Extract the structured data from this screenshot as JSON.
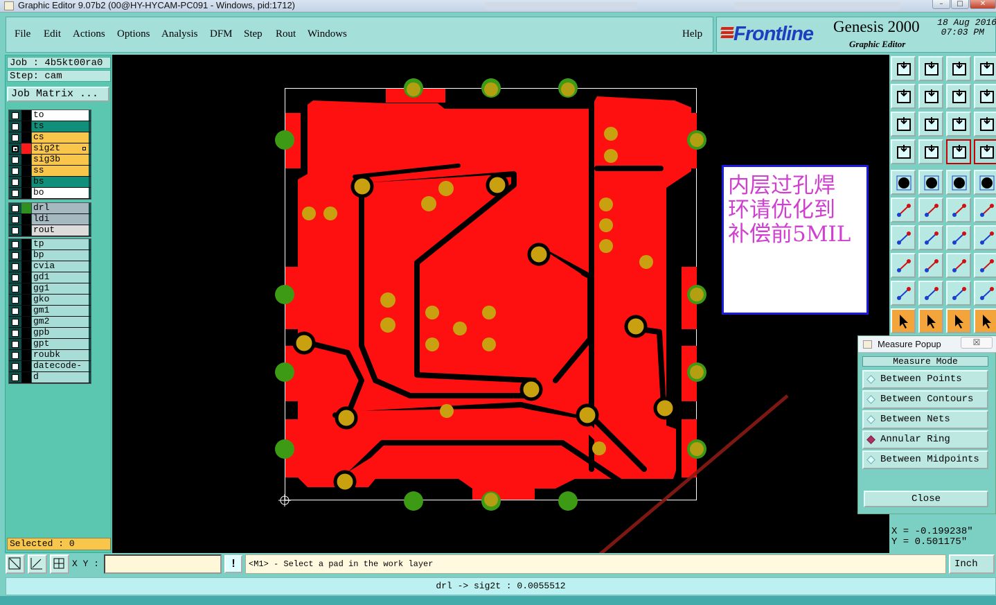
{
  "window": {
    "title": "Graphic Editor 9.07b2 (00@HY-HYCAM-PC091 - Windows, pid:1712)"
  },
  "menu": {
    "items": [
      "File",
      "Edit",
      "Actions",
      "Options",
      "Analysis",
      "DFM",
      "Step",
      "Rout",
      "Windows"
    ],
    "help": "Help"
  },
  "brand": {
    "logo": "Frontline",
    "product": "Genesis 2000",
    "subtitle": "Graphic Editor",
    "date": "18 Aug 2016",
    "time": "07:03 PM"
  },
  "job": {
    "job_line": "Job : 4b5kt00ra0",
    "step_line": "Step: cam",
    "matrix_button": "Job Matrix ..."
  },
  "layers": {
    "group1": [
      {
        "name": "to",
        "color": "#ffffff",
        "swatch": "#000000"
      },
      {
        "name": "ts",
        "color": "#10907a",
        "swatch": "#000000"
      },
      {
        "name": "cs",
        "color": "#f7c64a",
        "swatch": "#000000"
      },
      {
        "name": "sig2t",
        "color": "#f7c64a",
        "swatch": "#ff1a1a",
        "active": true
      },
      {
        "name": "sig3b",
        "color": "#f7c64a",
        "swatch": "#000000"
      },
      {
        "name": "ss",
        "color": "#f7c64a",
        "swatch": "#000000"
      },
      {
        "name": "bs",
        "color": "#10907a",
        "swatch": "#000000"
      },
      {
        "name": "bo",
        "color": "#ffffff",
        "swatch": "#000000"
      }
    ],
    "group2": [
      {
        "name": "drl",
        "color": "#a6b8c0",
        "swatch": "#2f8f1f"
      },
      {
        "name": "ldi",
        "color": "#a6b8c0",
        "swatch": "#000000"
      },
      {
        "name": "rout",
        "color": "#dcdcdc",
        "swatch": "#000000"
      }
    ],
    "group3": [
      {
        "name": "tp",
        "color": "#a8dcd6",
        "swatch": "#000000"
      },
      {
        "name": "bp",
        "color": "#a8dcd6",
        "swatch": "#000000"
      },
      {
        "name": "cvia",
        "color": "#a8dcd6",
        "swatch": "#000000"
      },
      {
        "name": "gd1",
        "color": "#a8dcd6",
        "swatch": "#000000"
      },
      {
        "name": "gg1",
        "color": "#a8dcd6",
        "swatch": "#000000"
      },
      {
        "name": "gko",
        "color": "#a8dcd6",
        "swatch": "#000000"
      },
      {
        "name": "gm1",
        "color": "#a8dcd6",
        "swatch": "#000000"
      },
      {
        "name": "gm2",
        "color": "#a8dcd6",
        "swatch": "#000000"
      },
      {
        "name": "gpb",
        "color": "#a8dcd6",
        "swatch": "#000000"
      },
      {
        "name": "gpt",
        "color": "#a8dcd6",
        "swatch": "#000000"
      },
      {
        "name": "roubk",
        "color": "#a8dcd6",
        "swatch": "#000000"
      },
      {
        "name": "datecode-bo",
        "color": "#a8dcd6",
        "swatch": "#000000"
      },
      {
        "name": "d",
        "color": "#a8dcd6",
        "swatch": "#000000"
      }
    ],
    "selected": "Selected : 0"
  },
  "annotation": {
    "lines": [
      "内层过孔焊",
      "环请优化到",
      "补偿前5MIL"
    ],
    "color": "#d040d0"
  },
  "measure_popup": {
    "title": "Measure Popup",
    "title_close": "☒",
    "header": "Measure Mode",
    "options": [
      {
        "label": "Between Points",
        "selected": false
      },
      {
        "label": "Between Contours",
        "selected": false
      },
      {
        "label": "Between Nets",
        "selected": false
      },
      {
        "label": "Annular Ring",
        "selected": true
      },
      {
        "label": "Between Midpoints",
        "selected": false
      }
    ],
    "close": "Close"
  },
  "coords": {
    "x": "X = -0.199238\"",
    "y": "Y = 0.501175\""
  },
  "status": {
    "xy_label": "X Y :",
    "xy_value": "",
    "prompt": "<M1> - Select a pad in the work layer",
    "unit": "Inch",
    "warn": "!"
  },
  "message": "drl -> sig2t : 0.0055512",
  "colors": {
    "copper": "#ff1010",
    "pad": "#c8a010",
    "drill_green": "#3c9a14",
    "board_outline": "#ffffff",
    "arrow": "#8a1a14"
  }
}
